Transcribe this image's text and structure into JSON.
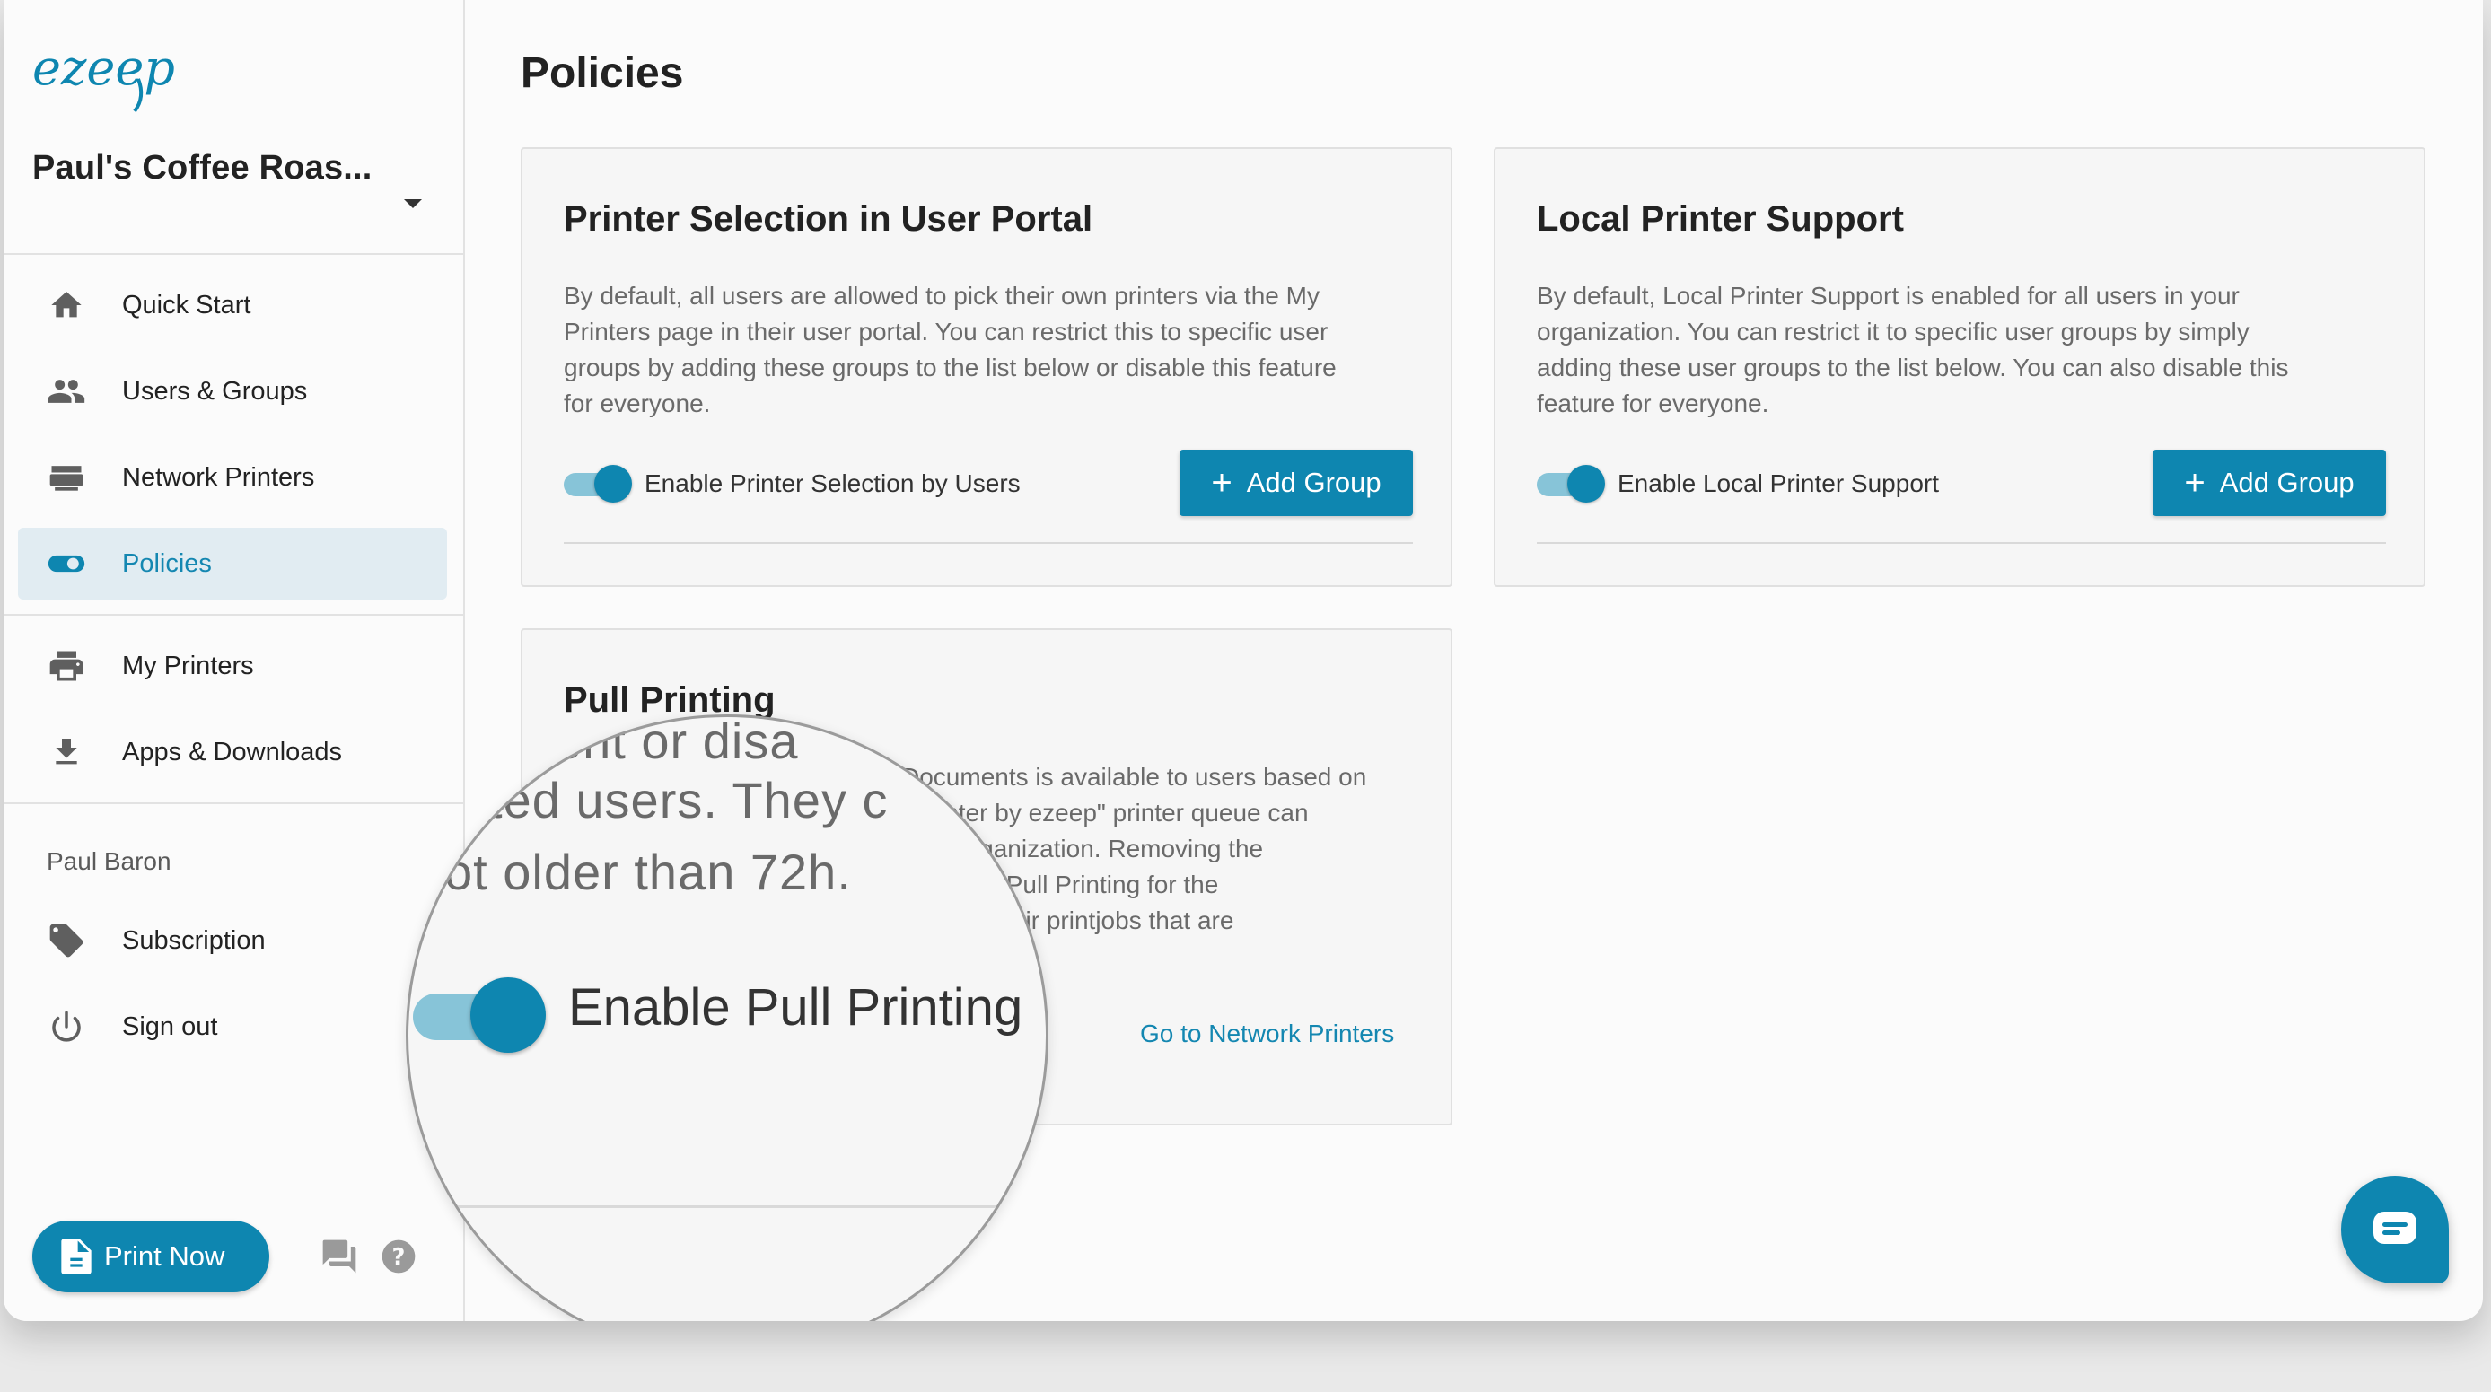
{
  "brand": {
    "logo_text": "ezeep",
    "accent_color": "#0e86b0"
  },
  "sidebar": {
    "org_name": "Paul's Coffee Roas...",
    "items": [
      {
        "label": "Quick Start",
        "icon": "home-icon"
      },
      {
        "label": "Users & Groups",
        "icon": "people-icon"
      },
      {
        "label": "Network Printers",
        "icon": "network-printer-icon"
      },
      {
        "label": "Policies",
        "icon": "toggle-icon",
        "active": true
      },
      {
        "label": "My Printers",
        "icon": "printer-icon"
      },
      {
        "label": "Apps & Downloads",
        "icon": "download-icon"
      }
    ],
    "user_name": "Paul Baron",
    "account_items": [
      {
        "label": "Subscription",
        "icon": "tag-icon"
      },
      {
        "label": "Sign out",
        "icon": "power-icon"
      }
    ],
    "print_now_label": "Print Now"
  },
  "main": {
    "title": "Policies",
    "cards": {
      "printer_selection": {
        "title": "Printer Selection in User Portal",
        "desc_lines": [
          "By default, all users are allowed to pick their own printers via the My",
          "Printers page in their user portal. You can restrict this to specific user",
          "groups by adding these groups to the list below or disable this feature",
          "for everyone."
        ],
        "toggle_label": "Enable Printer Selection by Users",
        "toggle_on": true,
        "button_label": "Add Group"
      },
      "local_printer": {
        "title": "Local Printer Support",
        "desc_lines": [
          "By default, Local Printer Support is enabled for all users in your",
          "organization. You can restrict it to specific user groups by simply",
          "adding these user groups to the list below. You can also disable this",
          "feature for everyone."
        ],
        "toggle_label": "Enable Local Printer Support",
        "toggle_on": true,
        "button_label": "Add Group"
      },
      "pull_printing": {
        "title": "Pull Printing",
        "desc_fragments": [
          "Documents is available to users based on",
          "yPrinter by ezeep\" printer queue can",
          "your organization. Removing the",
          "ll disable Pull Printing for the",
          "release their printjobs that are"
        ],
        "link_label": "Go to Network Printers"
      }
    },
    "magnifier": {
      "line1": "ent or disa",
      "line2": "cted users. They c",
      "line3": "ot older than 72h.",
      "toggle_label": "Enable Pull Printing",
      "toggle_on": true
    }
  }
}
